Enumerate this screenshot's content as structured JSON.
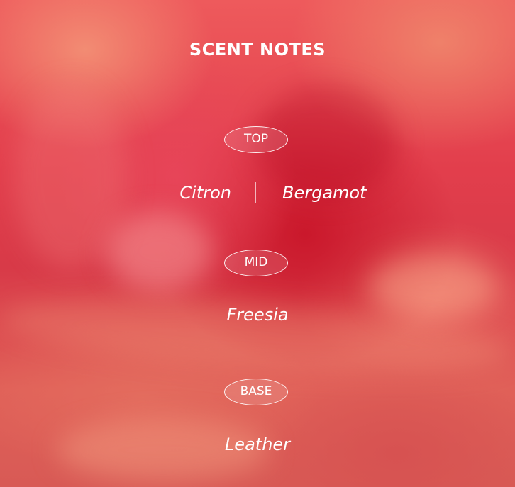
{
  "heading": "SCENT NOTES",
  "colors": {
    "text": "#ffffff",
    "background_primary": "#e23e4c",
    "background_accent": "#f4967a"
  },
  "tiers": {
    "top": {
      "label": "TOP",
      "notes": [
        "Citron",
        "Bergamot"
      ]
    },
    "mid": {
      "label": "MID",
      "notes": [
        "Freesia"
      ]
    },
    "base": {
      "label": "BASE",
      "notes": [
        "Leather"
      ]
    }
  }
}
